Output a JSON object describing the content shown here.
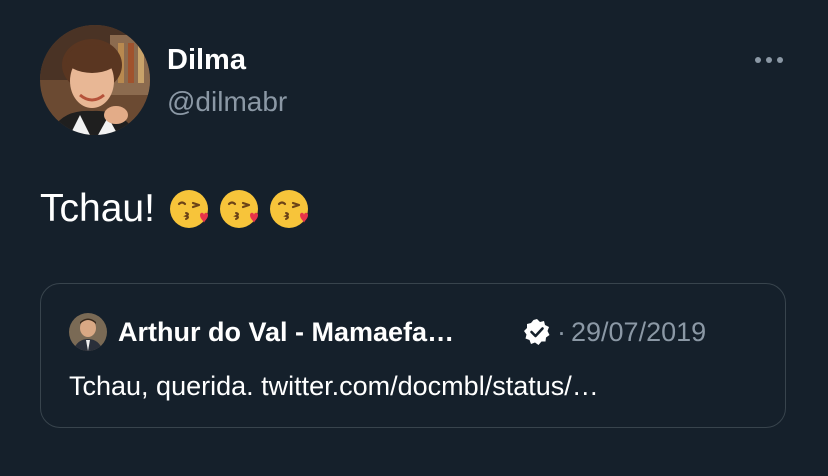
{
  "tweet": {
    "display_name": "Dilma",
    "handle": "@dilmabr",
    "text": "Tchau!",
    "emojis": [
      "face-blowing-a-kiss-emoji",
      "face-blowing-a-kiss-emoji",
      "face-blowing-a-kiss-emoji"
    ]
  },
  "more_menu": {
    "icon": "more-horizontal-icon"
  },
  "quoted_tweet": {
    "display_name": "Arthur do Val - Mamaefa…",
    "verified_icon": "verified-badge-icon",
    "separator": "·",
    "date": "29/07/2019",
    "text": "Tchau, querida. twitter.com/docmbl/status/…"
  },
  "colors": {
    "background": "#15202b",
    "primary_text": "#ffffff",
    "secondary_text": "#8b98a5",
    "border": "#38444d"
  }
}
